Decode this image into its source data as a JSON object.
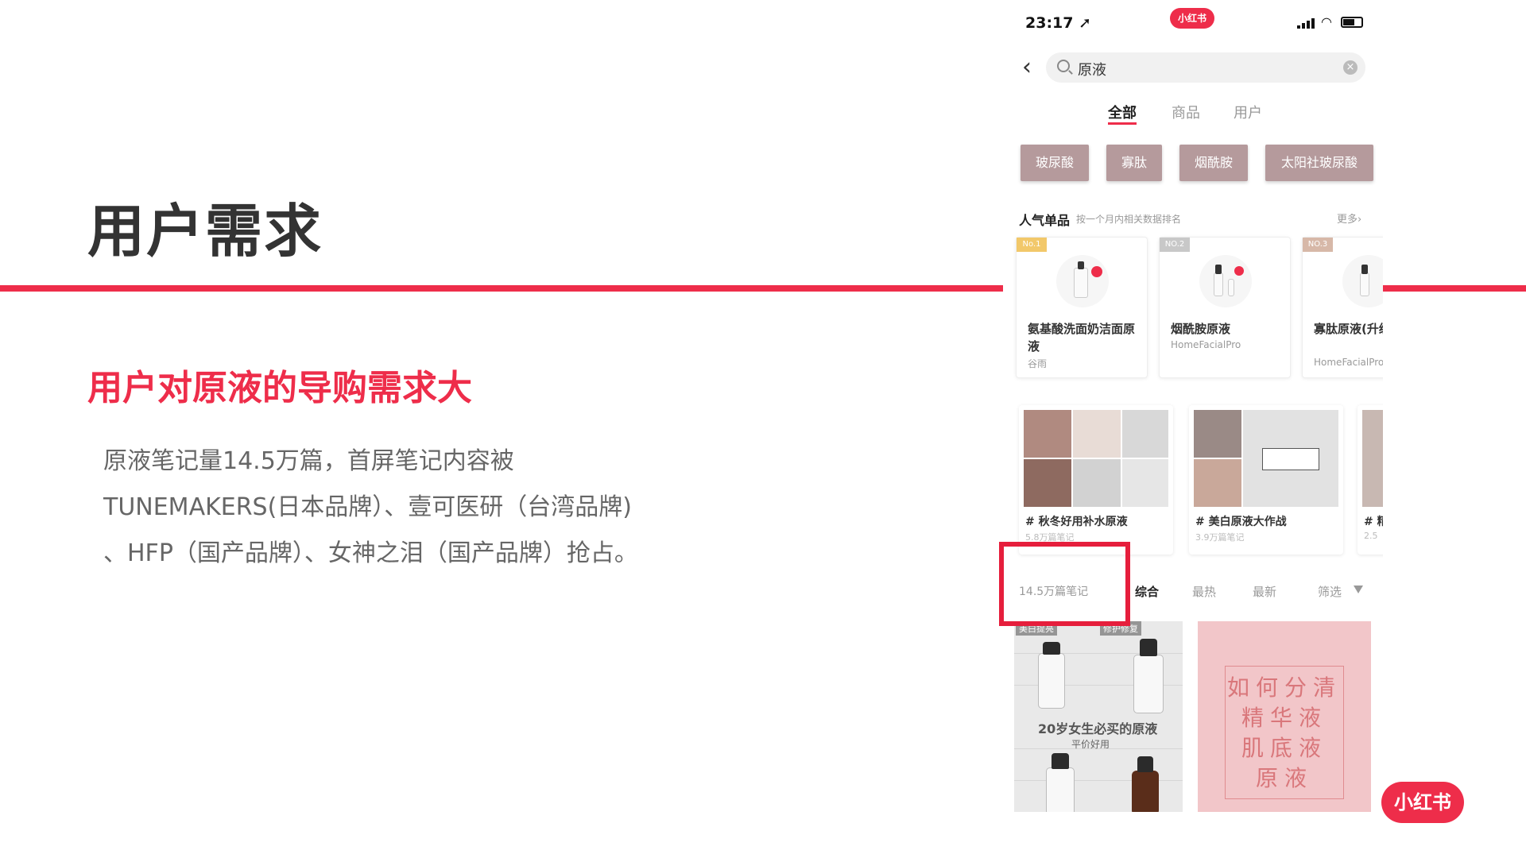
{
  "slide": {
    "title": "用户需求",
    "subtitle": "用户对原液的导购需求大",
    "body_lines": [
      "原液笔记量14.5万篇，首屏笔记内容被",
      "TUNEMAKERS(日本品牌）、壹可医研（台湾品牌)",
      "、HFP（国产品牌）、女神之泪（国产品牌）抢占。"
    ],
    "accent_color": "#ee2d4a",
    "logo": "小红书"
  },
  "phone": {
    "status": {
      "time": "23:17",
      "location_arrow": "➚",
      "app_pill": "小红书"
    },
    "search": {
      "back_icon": "‹",
      "query": "原液",
      "clear_icon": "×"
    },
    "tabs": [
      "全部",
      "商品",
      "用户"
    ],
    "chips": [
      "玻尿酸",
      "寡肽",
      "烟酰胺",
      "太阳社玻尿酸"
    ],
    "popular": {
      "heading": "人气单品",
      "sub": "按一个月内相关数据排名",
      "more": "更多›",
      "products": [
        {
          "rank": "No.1",
          "name": "氨基酸洗面奶洁面原液",
          "brand": "谷雨",
          "rank_color": "#f2c86a"
        },
        {
          "rank": "NO.2",
          "name": "烟酰胺原液",
          "brand": "HomeFacialPro",
          "rank_color": "#c8c8c8"
        },
        {
          "rank": "NO.3",
          "name": "寡肽原液(升级版)",
          "brand": "HomeFacialPro",
          "rank_color": "#d7b8a8"
        }
      ]
    },
    "topics": [
      {
        "title": "# 秋冬好用补水原液",
        "count": "5.8万篇笔记"
      },
      {
        "title": "# 美白原液大作战",
        "count": "3.9万篇笔记"
      },
      {
        "title": "# 精",
        "count": "2.5"
      }
    ],
    "notes_bar": {
      "count": "14.5万篇笔记",
      "sorts": [
        "综合",
        "最热",
        "最新",
        "筛选"
      ]
    },
    "note_left": {
      "tag1": "美白提亮",
      "tag2": "修护修复",
      "title": "20岁女生必买的原液",
      "sub": "平价好用"
    },
    "note_right": {
      "lines": [
        "如何分清",
        "精华液",
        "肌底液",
        "原液"
      ]
    }
  }
}
